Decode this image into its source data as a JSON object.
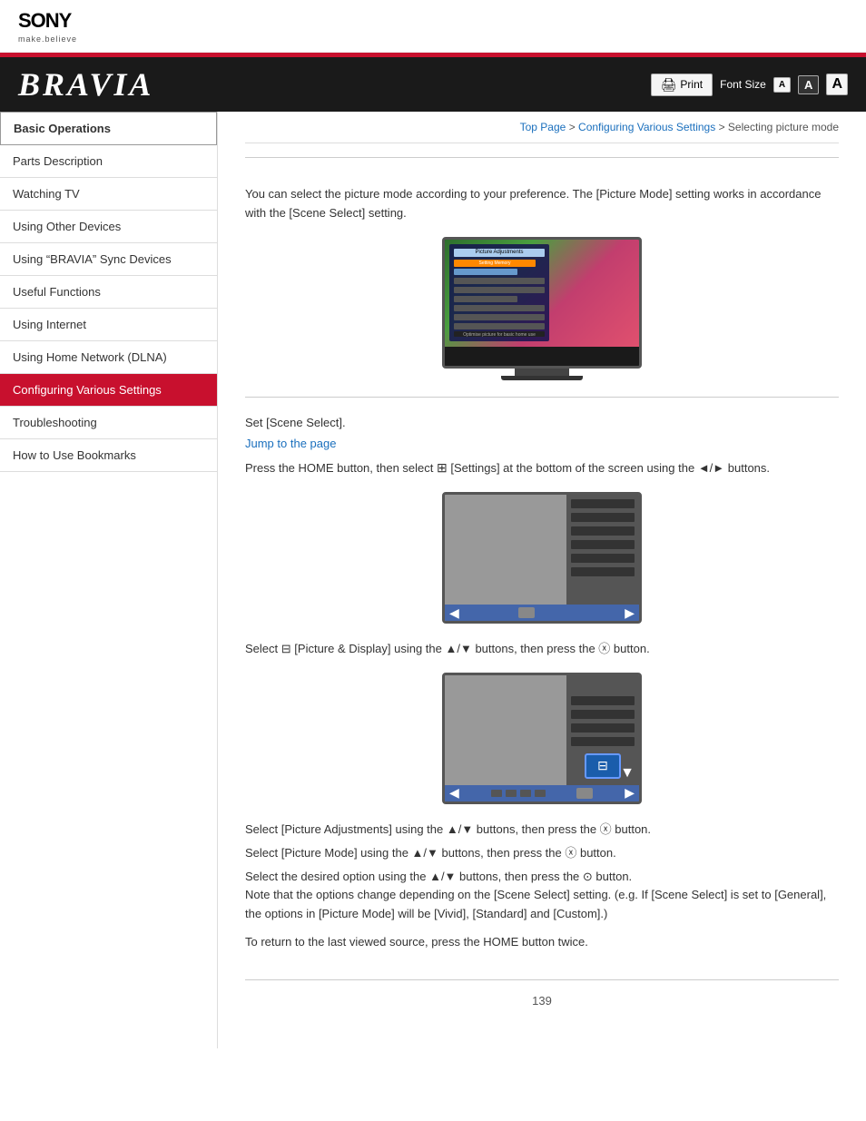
{
  "header": {
    "sony_logo": "SONY",
    "sony_tagline": "make.believe",
    "bravia_logo": "BRAVIA"
  },
  "toolbar": {
    "print_label": "Print",
    "font_size_label": "Font Size",
    "font_small": "A",
    "font_medium": "A",
    "font_large": "A"
  },
  "breadcrumb": {
    "top_page": "Top Page",
    "separator1": " > ",
    "configuring": "Configuring Various Settings",
    "separator2": " > ",
    "current": "Selecting picture mode"
  },
  "sidebar": {
    "items": [
      {
        "id": "basic-operations",
        "label": "Basic Operations",
        "active": false,
        "top": true
      },
      {
        "id": "parts-description",
        "label": "Parts Description",
        "active": false
      },
      {
        "id": "watching-tv",
        "label": "Watching TV",
        "active": false
      },
      {
        "id": "using-other-devices",
        "label": "Using Other Devices",
        "active": false
      },
      {
        "id": "using-bravia-sync",
        "label": "Using “BRAVIA” Sync Devices",
        "active": false
      },
      {
        "id": "useful-functions",
        "label": "Useful Functions",
        "active": false
      },
      {
        "id": "using-internet",
        "label": "Using Internet",
        "active": false
      },
      {
        "id": "using-home-network",
        "label": "Using Home Network (DLNA)",
        "active": false
      },
      {
        "id": "configuring-various-settings",
        "label": "Configuring Various Settings",
        "active": true
      },
      {
        "id": "troubleshooting",
        "label": "Troubleshooting",
        "active": false
      },
      {
        "id": "how-to-use-bookmarks",
        "label": "How to Use Bookmarks",
        "active": false
      }
    ]
  },
  "content": {
    "intro_paragraph": "You can select the picture mode according to your preference. The [Picture Mode] setting works in accordance with the [Scene Select] setting.",
    "step1_label": "Set [Scene Select].",
    "step1_link": "Jump to the page",
    "step2_text": "Press the HOME button, then select",
    "step2_settings_icon": "⌂",
    "step2_text2": "[Settings] at the bottom of the screen using the ◄/► buttons.",
    "step3_text": "Select",
    "step3_icon": "⌂",
    "step3_text2": "[Picture & Display] using the ▲/▼ buttons, then press the ⓧ button.",
    "step4_text": "Select [Picture Adjustments] using the ▲/▼ buttons, then press the ⓧ button.",
    "step5_text": "Select [Picture Mode] using the ▲/▼ buttons, then press the ⓧ button.",
    "step6_text": "Select the desired option using the ▲/▼ buttons, then press the ⓧ button.\nNote that the options change depending on the [Scene Select] setting. (e.g. If [Scene Select] is set to [General], the options in [Picture Mode] will be [Vivid], [Standard] and [Custom].)",
    "step7_text": "To return to the last viewed source, press the HOME button twice.",
    "footer_page": "139"
  },
  "colors": {
    "accent_red": "#c8102e",
    "link_blue": "#1a6fbd",
    "sidebar_border": "#ddd",
    "header_dark": "#1a1a1a"
  }
}
